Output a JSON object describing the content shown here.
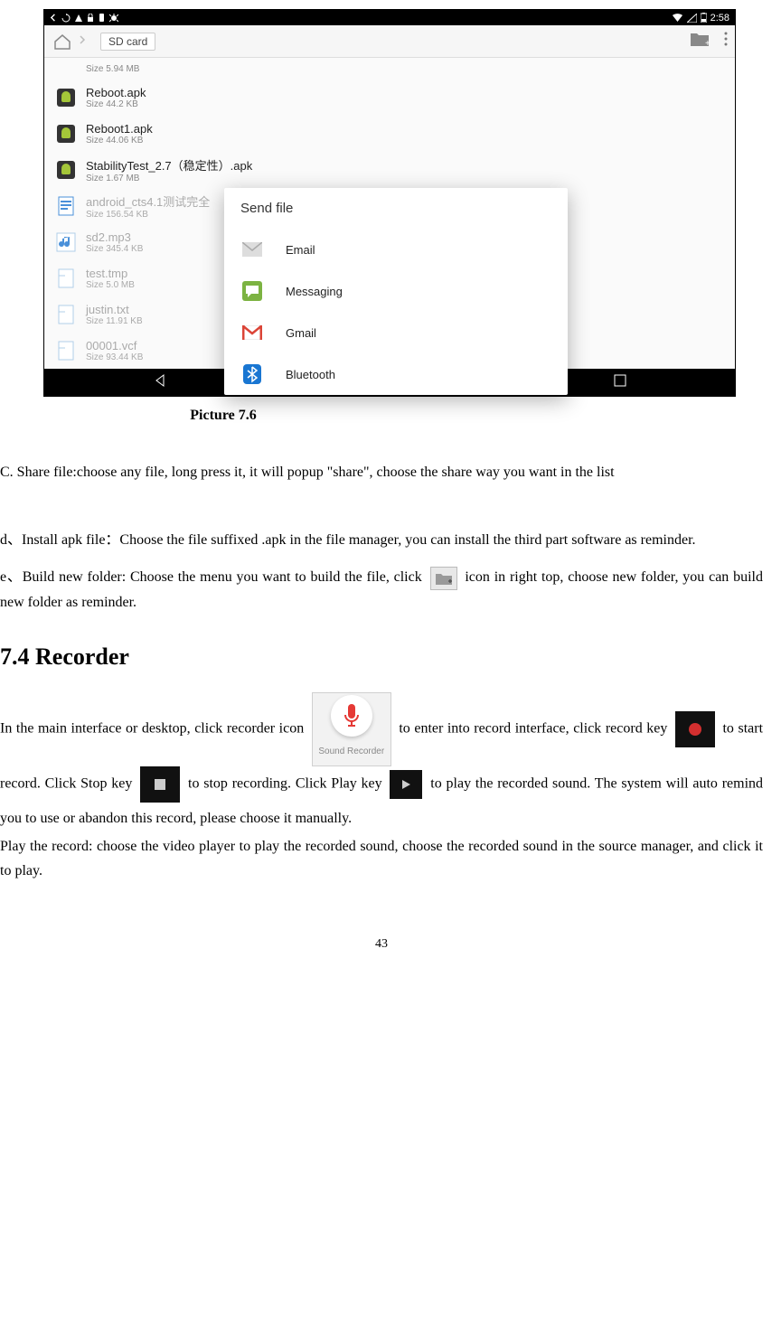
{
  "screenshot": {
    "status_time": "2:58",
    "breadcrumb": "SD card",
    "files": [
      {
        "name": "",
        "size": "Size 5.94 MB",
        "kind": "folder-partial"
      },
      {
        "name": "Reboot.apk",
        "size": "Size 44.2 KB",
        "kind": "apk"
      },
      {
        "name": "Reboot1.apk",
        "size": "Size 44.06 KB",
        "kind": "apk"
      },
      {
        "name": "StabilityTest_2.7（稳定性）.apk",
        "size": "Size 1.67 MB",
        "kind": "apk"
      },
      {
        "name": "android_cts4.1测试完全",
        "size": "Size 156.54 KB",
        "kind": "doc",
        "faded": true
      },
      {
        "name": "sd2.mp3",
        "size": "Size 345.4 KB",
        "kind": "audio",
        "faded": true
      },
      {
        "name": "test.tmp",
        "size": "Size 5.0 MB",
        "kind": "file",
        "faded": true
      },
      {
        "name": "justin.txt",
        "size": "Size 11.91 KB",
        "kind": "file",
        "faded": true
      },
      {
        "name": "00001.vcf",
        "size": "Size 93.44 KB",
        "kind": "file",
        "faded": true
      }
    ],
    "dialog": {
      "title": "Send file",
      "options": [
        "Email",
        "Messaging",
        "Gmail",
        "Bluetooth"
      ]
    }
  },
  "caption": "Picture 7.6",
  "para_c": "C. Share file:choose any file, long press it, it will popup \"share\", choose the share way you want in the list",
  "para_d": "d、Install apk file：Choose the file suffixed .apk in the file manager, you can install the third part software as reminder.",
  "para_e_pre": "e、Build new folder: Choose the menu you want to build the file, click ",
  "para_e_post": " icon in right top, choose new folder, you can build new folder as reminder.",
  "heading": "7.4 Recorder",
  "recorder": {
    "p1_pre": "In the main interface or desktop, click recorder icon ",
    "app_label": "Sound Recorder",
    "p1_post": " to enter into record interface, click record key ",
    "p1_post2": " to start record. Click Stop key ",
    "p1_post3": " to stop recording. Click Play key ",
    "p1_post4": " to play the recorded sound. The system will auto remind you to use or abandon this record, please choose it manually.",
    "p2": "Play the record: choose the video player to play the recorded sound, choose the recorded sound in the source manager, and click it to play."
  },
  "page_number": "43"
}
